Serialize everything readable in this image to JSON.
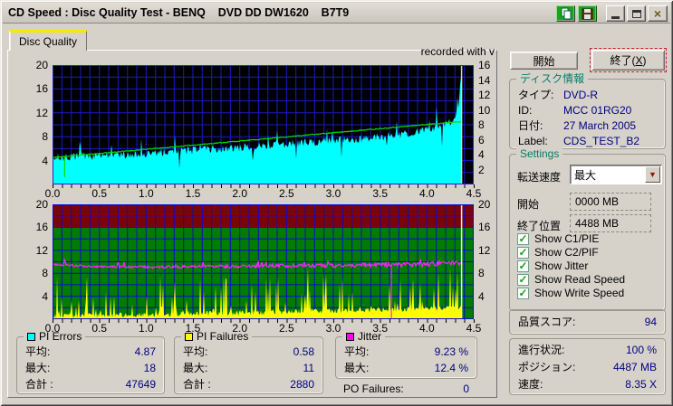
{
  "window": {
    "title": "CD Speed : Disc Quality Test - BENQ    DVD DD DW1620    B7T9"
  },
  "tab": {
    "label": "Disc Quality"
  },
  "chart_note": "recorded with  v",
  "chart_data": [
    {
      "type": "area",
      "title": "PI Errors vs disc position",
      "x_axis": {
        "range": [
          0,
          4.5
        ],
        "ticks": [
          "0.0",
          "0.5",
          "1.0",
          "1.5",
          "2.0",
          "2.5",
          "3.0",
          "3.5",
          "4.0",
          "4.5"
        ],
        "grid_step": 0.1
      },
      "left_axis": {
        "range": [
          0,
          20
        ],
        "ticks": [
          4,
          8,
          12,
          16,
          20
        ],
        "grid_step": 2
      },
      "right_axis": {
        "range": [
          0,
          16
        ],
        "ticks": [
          2,
          4,
          6,
          8,
          10,
          12,
          14,
          16
        ]
      },
      "background": "#000000",
      "grid_color": "#1a1acd",
      "border_color": "#2424d8",
      "end_of_data_x": 4.37,
      "end_line_color": "#cfcfcf",
      "series": [
        {
          "name": "PI Errors",
          "type": "area",
          "color": "#00ffff",
          "axis": "left",
          "seed": 7,
          "envelope_x": [
            0,
            0.5,
            1,
            1.5,
            2,
            2.5,
            3,
            3.5,
            4,
            4.25,
            4.33,
            4.365
          ],
          "envelope_y": [
            4.5,
            4.8,
            5.2,
            5.7,
            6.2,
            6.8,
            7.3,
            8.0,
            9.0,
            10.5,
            12.5,
            17.5
          ],
          "noise": 0.7,
          "spike_rate": 0.07,
          "spike_max": 3.5,
          "spike_pow": 1.6,
          "dip_rate": 0.05,
          "dip_max": 3.5,
          "min": 1.2
        },
        {
          "name": "Write Speed",
          "type": "line",
          "color": "#00dd00",
          "axis": "right",
          "seed": 11,
          "envelope_x": [
            0,
            4.365
          ],
          "envelope_y": [
            3.6,
            8.45
          ],
          "noise": 0.06,
          "drops": [
            {
              "x": 0.13,
              "to": 1.0
            }
          ]
        }
      ]
    },
    {
      "type": "area",
      "title": "PI Failures and Jitter vs disc position",
      "x_axis": {
        "range": [
          0,
          4.5
        ],
        "ticks": [
          "0.0",
          "0.5",
          "1.0",
          "1.5",
          "2.0",
          "2.5",
          "3.0",
          "3.5",
          "4.0",
          "4.5"
        ],
        "grid_step": 0.1
      },
      "left_axis": {
        "range": [
          0,
          20
        ],
        "ticks": [
          4,
          8,
          12,
          16,
          20
        ],
        "grid_step": 2
      },
      "right_axis": {
        "range": [
          0,
          20
        ],
        "ticks": [
          4,
          8,
          12,
          16,
          20
        ]
      },
      "background": "#007c00",
      "band": {
        "from": 16,
        "to": 20,
        "color": "#7c0404"
      },
      "grid_color": "#0a0ad0",
      "border_color": "#0a0ad0",
      "end_of_data_x": 4.37,
      "end_line_color": "#e8e8e8",
      "series": [
        {
          "name": "PI Failures",
          "type": "area",
          "color": "#ffff00",
          "axis": "left",
          "seed": 23,
          "envelope_x": [
            0,
            0.5,
            1,
            1.5,
            2,
            2.5,
            3,
            3.5,
            4,
            4.365
          ],
          "envelope_y": [
            0.55,
            0.7,
            0.8,
            0.95,
            1.05,
            1.25,
            1.45,
            1.65,
            1.85,
            1.95
          ],
          "noise": 0.45,
          "spike_rate": 0.3,
          "spike_max": 7.5,
          "spike_pow": 3,
          "min": 0.15
        },
        {
          "name": "Jitter",
          "type": "line",
          "color": "#ff22ff",
          "axis": "left",
          "seed": 41,
          "envelope_x": [
            0,
            0.5,
            1,
            1.5,
            2,
            2.5,
            3,
            3.5,
            4,
            4.365
          ],
          "envelope_y": [
            9.5,
            9.15,
            9.1,
            9.15,
            9.2,
            9.3,
            9.3,
            9.45,
            9.6,
            9.8
          ],
          "noise": 0.3,
          "noise_ramp": 1.1,
          "spike_rate": 0.05,
          "spike_max": 1.2,
          "drops": [
            {
              "x": 3.62,
              "to": 0.2
            }
          ]
        }
      ]
    }
  ],
  "stats": {
    "pi_errors": {
      "title": "PI Errors",
      "swatch": "#00ffff",
      "rows": [
        {
          "label": "平均:",
          "value": "4.87"
        },
        {
          "label": "最大:",
          "value": "18"
        },
        {
          "label": "合計 :",
          "value": "47649"
        }
      ]
    },
    "pi_failures": {
      "title": "PI Failures",
      "swatch": "#ffff00",
      "rows": [
        {
          "label": "平均:",
          "value": "0.58"
        },
        {
          "label": "最大:",
          "value": "11"
        },
        {
          "label": "合計 :",
          "value": "2880"
        }
      ]
    },
    "jitter": {
      "title": "Jitter",
      "swatch": "#ff00ff",
      "rows": [
        {
          "label": "平均:",
          "value": "9.23 %"
        },
        {
          "label": "最大:",
          "value": "12.4 %"
        }
      ]
    },
    "po_failures": {
      "label": "PO Failures:",
      "value": "0"
    }
  },
  "panel": {
    "start_button": "開始",
    "exit_button": {
      "pre": "終了(",
      "key": "X",
      "post": ")"
    },
    "disc_info": {
      "title": "ディスク情報",
      "rows": [
        {
          "label": "タイプ:",
          "value": "DVD-R"
        },
        {
          "label": "ID:",
          "value": "MCC 01RG20"
        },
        {
          "label": "日付:",
          "value": "27 March 2005"
        },
        {
          "label": "Label:",
          "value": "CDS_TEST_B2"
        }
      ]
    },
    "settings": {
      "title": "Settings",
      "speed_label": "転送速度",
      "speed_value": "最大",
      "start_label": "開始",
      "start_value": "0000 MB",
      "end_label": "終了位置",
      "end_value": "4488 MB",
      "checkboxes": [
        {
          "label": "Show C1/PIE",
          "checked": true
        },
        {
          "label": "Show C2/PIF",
          "checked": true
        },
        {
          "label": "Show Jitter",
          "checked": true
        },
        {
          "label": "Show Read Speed",
          "checked": true
        },
        {
          "label": "Show Write Speed",
          "checked": true
        }
      ]
    },
    "quality": {
      "label": "品質スコア:",
      "value": "94"
    },
    "progress": {
      "rows": [
        {
          "label": "進行状況:",
          "value": "100 %"
        },
        {
          "label": "ポジション:",
          "value": "4487 MB"
        },
        {
          "label": "速度:",
          "value": "8.35 X"
        }
      ]
    }
  },
  "colors": {
    "value_text": "#000080",
    "group_title": "#0a7a68",
    "check_green": "#16a016",
    "pi_errors": "#00ffff",
    "pi_failures": "#ffff00",
    "jitter": "#ff00ff",
    "write_speed": "#00dd00"
  }
}
